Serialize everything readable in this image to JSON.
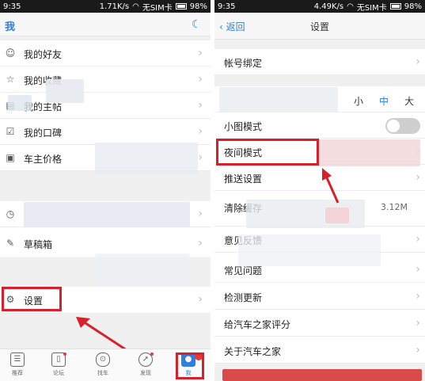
{
  "left": {
    "status": {
      "time": "9:35",
      "speed": "1.71K/s",
      "carrier": "无SIM卡",
      "battery": "98%"
    },
    "header": {
      "title": "我"
    },
    "menu": [
      {
        "label": "我的好友",
        "icon": "user-icon"
      },
      {
        "label": "我的收藏",
        "icon": "star-icon"
      },
      {
        "label": "我的主帖",
        "icon": "document-icon"
      },
      {
        "label": "我的口碑",
        "icon": "checkbox-icon"
      },
      {
        "label": "车主价格",
        "icon": "price-tag-icon"
      },
      {
        "label": "",
        "icon": "clock-icon"
      },
      {
        "label": "草稿箱",
        "icon": "edit-icon"
      },
      {
        "label": "设置",
        "icon": "gear-icon"
      }
    ],
    "tabs": [
      {
        "label": "推荐",
        "icon": "news-icon"
      },
      {
        "label": "论坛",
        "icon": "forum-icon"
      },
      {
        "label": "找车",
        "icon": "car-icon"
      },
      {
        "label": "发现",
        "icon": "compass-icon"
      },
      {
        "label": "我",
        "icon": "person-icon"
      }
    ]
  },
  "right": {
    "status": {
      "time": "9:35",
      "speed": "4.49K/s",
      "carrier": "无SIM卡",
      "battery": "98%"
    },
    "header": {
      "back": "返回",
      "title": "设置"
    },
    "account": "帐号绑定",
    "font_sizes": [
      "小",
      "中",
      "大"
    ],
    "font_size_selected": "中",
    "small_image_mode": "小图模式",
    "night_mode": "夜间模式",
    "push": "推送设置",
    "cache": {
      "label": "清除缓存",
      "value": "3.12M"
    },
    "feedback": "意见反馈",
    "faq": "常见问题",
    "update": "检测更新",
    "rate": "给汽车之家评分",
    "about": "关于汽车之家"
  },
  "colors": {
    "accent": "#2f7fe0",
    "highlight": "#d8202a"
  }
}
